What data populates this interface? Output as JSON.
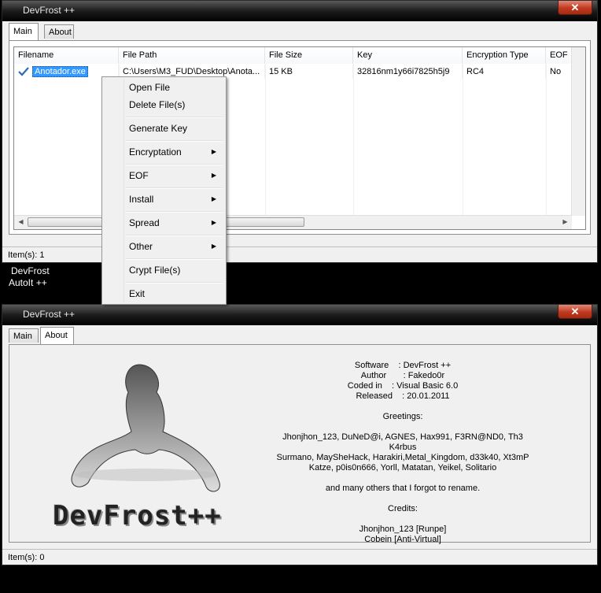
{
  "top_window": {
    "title": "DevFrost ++",
    "close_label": "✕",
    "tabs": [
      {
        "label": "Main"
      },
      {
        "label": "About"
      }
    ],
    "columns": [
      "Filename",
      "File Path",
      "File Size",
      "Key",
      "Encryption Type",
      "EOF"
    ],
    "rows": [
      {
        "filename": "Anotador.exe",
        "path": "C:\\Users\\M3_FUD\\Desktop\\Anota...",
        "size": "15 KB",
        "key": "32816nm1y66i7825h5j9",
        "encryption": "RC4",
        "eof": "No"
      }
    ],
    "status": "Item(s): 1"
  },
  "context_menu": {
    "items": [
      {
        "label": "Open File"
      },
      {
        "label": "Delete File(s)"
      },
      {
        "label": "Generate Key"
      },
      {
        "label": "Encryptation",
        "submenu": true
      },
      {
        "label": "EOF",
        "submenu": true
      },
      {
        "label": "Install",
        "submenu": true
      },
      {
        "label": "Spread",
        "submenu": true
      },
      {
        "label": "Other",
        "submenu": true
      },
      {
        "label": "Crypt File(s)"
      },
      {
        "label": "Exit"
      }
    ],
    "submenu_arrow": "▶"
  },
  "overlay": {
    "line1": "DevFrost",
    "line2": "AutoIt ++"
  },
  "bottom_window": {
    "title": "DevFrost ++",
    "close_label": "✕",
    "tabs": [
      {
        "label": "Main"
      },
      {
        "label": "About"
      }
    ],
    "about": {
      "info": [
        "Software    : DevFrost ++",
        "Author       : Fakedo0r",
        "Coded in    : Visual Basic 6.0",
        "Released    : 20.01.2011"
      ],
      "greetings_title": "Greetings:",
      "greetings": [
        "Jhonjhon_123, DuNeD@i, AGNES, Hax991, F3RN@ND0, Th3 K4rbus",
        "Surmano, MaySheHack, Harakiri,Metal_Kingdom, d33k40, Xt3mP",
        "Katze, p0is0n666, Yorll, Matatan, Yeikel, Solitario"
      ],
      "others": "and many others that I forgot to rename.",
      "credits_title": "Credits:",
      "credits": [
        "Jhonjhon_123 [Runpe]",
        "Cobein [Anti-Virtual]"
      ],
      "logo_text": "DevFrost++"
    },
    "status": "Item(s): 0"
  },
  "colors": {
    "selection": "#3399ff",
    "titlebar": "#1c1c1c",
    "close": "#c0391f"
  },
  "icons": {
    "check": "check-icon",
    "close": "close-icon"
  }
}
